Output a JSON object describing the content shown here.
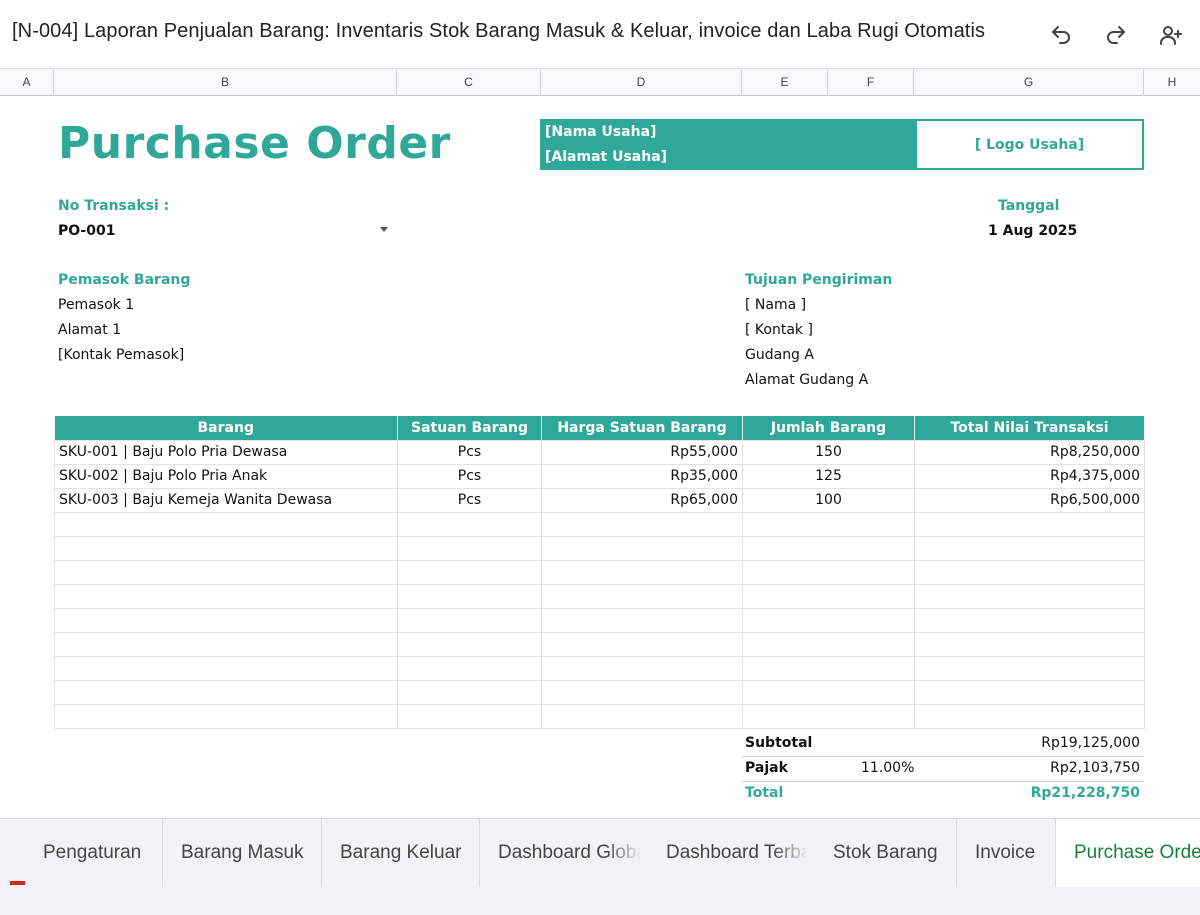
{
  "app": {
    "doc_title": "[N-004] Laporan Penjualan Barang: Inventaris Stok Barang Masuk & Keluar,  invoice dan Laba Rugi Otomatis",
    "toolbar_icons": [
      "undo-icon",
      "redo-icon",
      "add-person-icon"
    ]
  },
  "columns": [
    "A",
    "B",
    "C",
    "D",
    "E",
    "F",
    "G",
    "H"
  ],
  "purchase_order": {
    "title": "Purchase Order",
    "business_name": "[Nama Usaha]",
    "business_address": "[Alamat Usaha]",
    "logo_placeholder": "[ Logo Usaha]",
    "transaction_label": "No Transaksi :",
    "transaction_value": "PO-001",
    "date_label": "Tanggal",
    "date_value": "1 Aug 2025",
    "supplier": {
      "label": "Pemasok Barang",
      "lines": [
        "Pemasok 1",
        "Alamat 1",
        "[Kontak Pemasok]"
      ]
    },
    "shipping": {
      "label": "Tujuan Pengiriman",
      "lines": [
        "[ Nama ]",
        "[ Kontak ]",
        "Gudang A",
        "Alamat Gudang A"
      ]
    },
    "table": {
      "headers": [
        "Barang",
        "Satuan Barang",
        "Harga Satuan Barang",
        "Jumlah Barang",
        "Total Nilai Transaksi"
      ],
      "rows": [
        [
          "SKU-001 | Baju Polo Pria Dewasa",
          "Pcs",
          "Rp55,000",
          "150",
          "Rp8,250,000"
        ],
        [
          "SKU-002 | Baju Polo Pria Anak",
          "Pcs",
          "Rp35,000",
          "125",
          "Rp4,375,000"
        ],
        [
          "SKU-003 | Baju Kemeja Wanita Dewasa",
          "Pcs",
          "Rp65,000",
          "100",
          "Rp6,500,000"
        ],
        [
          "",
          "",
          "",
          "",
          ""
        ],
        [
          "",
          "",
          "",
          "",
          ""
        ],
        [
          "",
          "",
          "",
          "",
          ""
        ],
        [
          "",
          "",
          "",
          "",
          ""
        ],
        [
          "",
          "",
          "",
          "",
          ""
        ],
        [
          "",
          "",
          "",
          "",
          ""
        ],
        [
          "",
          "",
          "",
          "",
          ""
        ],
        [
          "",
          "",
          "",
          "",
          ""
        ],
        [
          "",
          "",
          "",
          "",
          ""
        ]
      ]
    },
    "totals": {
      "subtotal_label": "Subtotal",
      "subtotal_value": "Rp19,125,000",
      "tax_label": "Pajak",
      "tax_rate": "11.00%",
      "tax_value": "Rp2,103,750",
      "total_label": "Total",
      "total_value": "Rp21,228,750"
    }
  },
  "sheet_tabs": [
    {
      "label": "Pengaturan",
      "active": false
    },
    {
      "label": "Barang Masuk",
      "active": false
    },
    {
      "label": "Barang Keluar",
      "active": false
    },
    {
      "label": "Dashboard Global",
      "active": false
    },
    {
      "label": "Dashboard Terbaru",
      "active": false
    },
    {
      "label": "Stok Barang",
      "active": false
    },
    {
      "label": "Invoice",
      "active": false
    },
    {
      "label": "Purchase Order",
      "active": true
    }
  ],
  "colors": {
    "accent": "#2fa89a",
    "active_tab_text": "#188038"
  }
}
